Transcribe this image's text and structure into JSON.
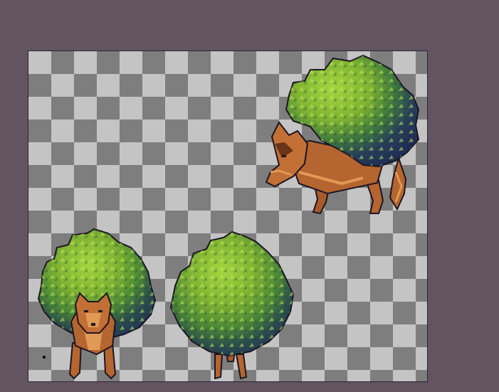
{
  "canvas": {
    "background": "transparency-checkerboard",
    "checker_colors": [
      "#c4c4c4",
      "#7e7e7e"
    ]
  },
  "palette": {
    "leaf_light": "#a4d640",
    "leaf_mid": "#6fa52b",
    "leaf_dark": "#3c6e2e",
    "bush_shadow": "#2a4e4c",
    "bush_deep": "#22305a",
    "fur_light": "#e09a55",
    "fur_mid": "#b5652f",
    "fur_dark": "#6b3418",
    "outline": "#1b1624"
  },
  "sprites": [
    {
      "name": "bush-wolf-front",
      "view": "front",
      "icon": "bush-wolf-front-icon"
    },
    {
      "name": "bush-wolf-back",
      "view": "back",
      "icon": "bush-wolf-back-icon"
    },
    {
      "name": "bush-wolf-side",
      "view": "side",
      "icon": "bush-wolf-side-icon"
    }
  ]
}
